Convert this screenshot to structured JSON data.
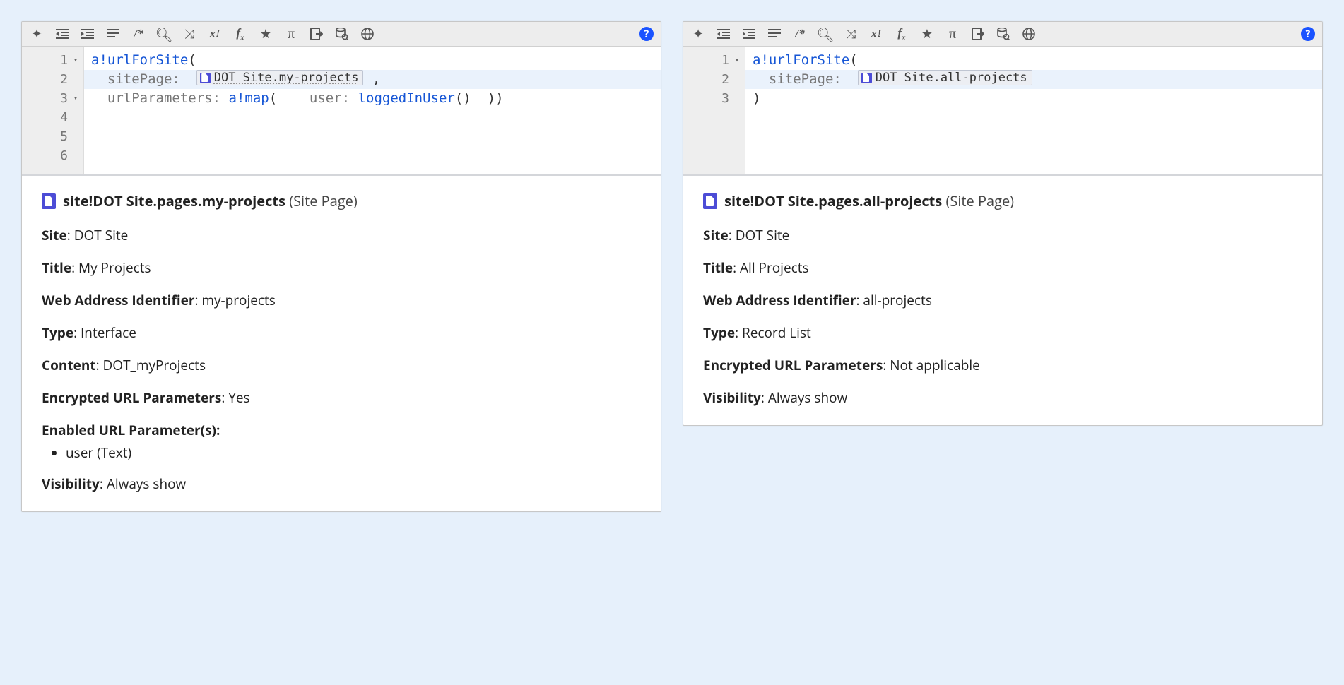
{
  "toolbar": {
    "magic": "✧",
    "outdent": "←",
    "indent": "→",
    "format": "≡",
    "comment": "/*",
    "search": "⌕",
    "shuffle": "⤨",
    "xbang": "x!",
    "fx": "fx",
    "star": "★",
    "pi": "π",
    "export": "↪",
    "dbsearch": "⛁",
    "globe": "⊕",
    "help": "?"
  },
  "panels": [
    {
      "code": {
        "lines": [
          {
            "num": "1",
            "fold": true,
            "tokens": [
              {
                "t": "fn",
                "v": "a!urlForSite"
              },
              {
                "t": "paren",
                "v": "("
              }
            ]
          },
          {
            "num": "2",
            "fold": false,
            "highlight": true,
            "tokens": [
              {
                "t": "sp",
                "v": "  "
              },
              {
                "t": "kw",
                "v": "sitePage:"
              },
              {
                "t": "sp",
                "v": "  "
              },
              {
                "t": "chip",
                "v": "DOT Site.my-projects",
                "u": true
              },
              {
                "t": "sp",
                "v": " "
              },
              {
                "t": "cursor"
              },
              {
                "t": "paren",
                "v": ","
              }
            ]
          },
          {
            "num": "3",
            "fold": true,
            "tokens": [
              {
                "t": "sp",
                "v": "  "
              },
              {
                "t": "kw",
                "v": "urlParameters:"
              },
              {
                "t": "sp",
                "v": " "
              },
              {
                "t": "fn",
                "v": "a!map"
              },
              {
                "t": "paren",
                "v": "("
              }
            ]
          },
          {
            "num": "4",
            "fold": false,
            "tokens": [
              {
                "t": "sp",
                "v": "    "
              },
              {
                "t": "kw",
                "v": "user:"
              },
              {
                "t": "sp",
                "v": " "
              },
              {
                "t": "fn",
                "v": "loggedInUser"
              },
              {
                "t": "paren",
                "v": "()"
              }
            ]
          },
          {
            "num": "5",
            "fold": false,
            "tokens": [
              {
                "t": "sp",
                "v": "  "
              },
              {
                "t": "paren",
                "v": ")"
              }
            ]
          },
          {
            "num": "6",
            "fold": false,
            "tokens": [
              {
                "t": "paren",
                "v": ")"
              }
            ]
          }
        ]
      },
      "info": {
        "title_main": "site!DOT Site.pages.my-projects",
        "title_suffix": "(Site Page)",
        "rows": [
          {
            "label": "Site",
            "value": "DOT Site"
          },
          {
            "label": "Title",
            "value": "My Projects"
          },
          {
            "label": "Web Address Identifier",
            "value": "my-projects"
          },
          {
            "label": "Type",
            "value": "Interface"
          },
          {
            "label": "Content",
            "value": "DOT_myProjects"
          },
          {
            "label": "Encrypted URL Parameters",
            "value": "Yes"
          }
        ],
        "param_header": "Enabled URL Parameter(s):",
        "params": [
          "user (Text)"
        ],
        "visibility_label": "Visibility",
        "visibility_value": "Always show"
      }
    },
    {
      "code": {
        "lines": [
          {
            "num": "1",
            "fold": true,
            "tokens": [
              {
                "t": "fn",
                "v": "a!urlForSite"
              },
              {
                "t": "paren",
                "v": "("
              }
            ]
          },
          {
            "num": "2",
            "fold": false,
            "highlight": true,
            "tokens": [
              {
                "t": "sp",
                "v": "  "
              },
              {
                "t": "kw",
                "v": "sitePage:"
              },
              {
                "t": "sp",
                "v": "  "
              },
              {
                "t": "chip",
                "v": "DOT Site.all-projects",
                "u": false
              }
            ]
          },
          {
            "num": "3",
            "fold": false,
            "tokens": [
              {
                "t": "paren",
                "v": ")"
              }
            ]
          }
        ]
      },
      "info": {
        "title_main": "site!DOT Site.pages.all-projects",
        "title_suffix": "(Site Page)",
        "rows": [
          {
            "label": "Site",
            "value": "DOT Site"
          },
          {
            "label": "Title",
            "value": "All Projects"
          },
          {
            "label": "Web Address Identifier",
            "value": "all-projects"
          },
          {
            "label": "Type",
            "value": "Record List"
          },
          {
            "label": "Encrypted URL Parameters",
            "value": "Not applicable"
          }
        ],
        "param_header": null,
        "params": [],
        "visibility_label": "Visibility",
        "visibility_value": "Always show"
      }
    }
  ]
}
